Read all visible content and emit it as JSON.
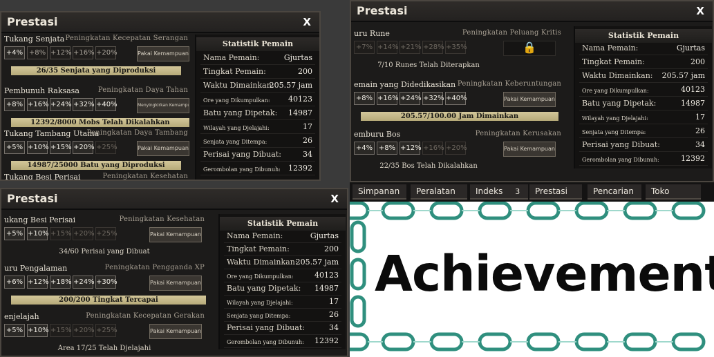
{
  "windows": [
    {
      "title": "Prestasi",
      "close": "X",
      "achievements": [
        {
          "name": "Tukang Senjata",
          "stat": "Peningkatan Kecepatan Serangan",
          "levels": [
            "+4%",
            "+8%",
            "+12%",
            "+16%",
            "+20%"
          ],
          "button": "Pakai Kemampuan",
          "progress": "26/35 Senjata yang Diproduksi"
        },
        {
          "name": "Pembunuh Raksasa",
          "stat": "Peningkatan Daya Tahan",
          "levels": [
            "+8%",
            "+16%",
            "+24%",
            "+32%",
            "+40%"
          ],
          "button": "Menyingkirkan Kemampuan",
          "progress": "12392/8000 Mobs Telah Dikalahkan"
        },
        {
          "name": "Tukang Tambang Utama",
          "stat": "Peningkatan Daya Tambang",
          "levels": [
            "+5%",
            "+10%",
            "+15%",
            "+20%",
            "+25%"
          ],
          "button": "Pakai Kemampuan",
          "progress": "14987/25000 Batu yang Diproduksi"
        },
        {
          "name": "Tukang Besi Perisai",
          "stat": "Peningkatan Kesehatan"
        }
      ],
      "stats_header": "Statistik Pemain",
      "stats": [
        {
          "k": "Nama Pemain:",
          "v": "Gjurtas"
        },
        {
          "k": "Tingkat Pemain:",
          "v": "200"
        },
        {
          "k": "Waktu Dimainkan:",
          "v": "205.57 jam"
        },
        {
          "k": "Ore yang Dikumpulkan:",
          "v": "40123"
        },
        {
          "k": "Batu yang Dipetak:",
          "v": "14987"
        },
        {
          "k": "Wilayah yang Djelajahi:",
          "v": "17"
        },
        {
          "k": "Senjata yang Ditempa:",
          "v": "26"
        },
        {
          "k": "Perisai yang Dibuat:",
          "v": "34"
        },
        {
          "k": "Gerombolan yang Dibunuh:",
          "v": "12392"
        }
      ]
    },
    {
      "title": "Prestasi",
      "close": "X",
      "achievements": [
        {
          "name": "uru Rune",
          "stat": "Peningkatan Peluang Kritis",
          "levels": [
            "+7%",
            "+14%",
            "+21%",
            "+28%",
            "+35%"
          ],
          "button": "🔒",
          "progress": "7/10 Runes Telah Diterapkan"
        },
        {
          "name": "emain yang Didedikasikan",
          "stat": "Peningkatan Keberuntungan",
          "levels": [
            "+8%",
            "+16%",
            "+24%",
            "+32%",
            "+40%"
          ],
          "button": "Pakai Kemampuan",
          "progress": "205.57/100.00 Jam Dimainkan"
        },
        {
          "name": "emburu Bos",
          "stat": "Peningkatan Kerusakan",
          "levels": [
            "+4%",
            "+8%",
            "+12%",
            "+16%",
            "+20%"
          ],
          "button": "Pakai Kemampuan",
          "progress": "22/35 Bos Telah Dikalahkan"
        }
      ],
      "stats_header": "Statistik Pemain",
      "stats": [
        {
          "k": "Nama Pemain:",
          "v": "Gjurtas"
        },
        {
          "k": "Tingkat Pemain:",
          "v": "200"
        },
        {
          "k": "Waktu Dimainkan:",
          "v": "205.57 jam"
        },
        {
          "k": "Ore yang Dikumpulkan:",
          "v": "40123"
        },
        {
          "k": "Batu yang Dipetak:",
          "v": "14987"
        },
        {
          "k": "Wilayah yang Djelajahi:",
          "v": "17"
        },
        {
          "k": "Senjata yang Ditempa:",
          "v": "26"
        },
        {
          "k": "Perisai yang Dibuat:",
          "v": "34"
        },
        {
          "k": "Gerombolan yang Dibunuh:",
          "v": "12392"
        }
      ]
    },
    {
      "title": "Prestasi",
      "close": "X",
      "achievements": [
        {
          "name": "ukang Besi Perisai",
          "stat": "Peningkatan Kesehatan",
          "levels": [
            "+5%",
            "+10%",
            "+15%",
            "+20%",
            "+25%"
          ],
          "button": "Pakai Kemampuan",
          "progress": "34/60 Perisai yang Dibuat"
        },
        {
          "name": "uru Pengalaman",
          "stat": "Peningkatan Pengganda XP",
          "levels": [
            "+6%",
            "+12%",
            "+18%",
            "+24%",
            "+30%"
          ],
          "button": "Pakai Kemampuan",
          "progress": "200/200 Tingkat Tercapai"
        },
        {
          "name": "enjelajah",
          "stat": "Peningkatan Kecepatan Gerakan",
          "levels": [
            "+5%",
            "+10%",
            "+15%",
            "+20%",
            "+25%"
          ],
          "button": "Pakai Kemampuan",
          "progress": "Area 17/25 Telah Djelajahi"
        }
      ],
      "stats_header": "Statistik Pemain",
      "stats": [
        {
          "k": "Nama Pemain:",
          "v": "Gjurtas"
        },
        {
          "k": "Tingkat Pemain:",
          "v": "200"
        },
        {
          "k": "Waktu Dimainkan:",
          "v": "205.57 jam"
        },
        {
          "k": "Ore yang Dikumpulkan:",
          "v": "40123"
        },
        {
          "k": "Batu yang Dipetak:",
          "v": "14987"
        },
        {
          "k": "Wilayah yang Djelajahi:",
          "v": "17"
        },
        {
          "k": "Senjata yang Ditempa:",
          "v": "26"
        },
        {
          "k": "Perisai yang Dibuat:",
          "v": "34"
        },
        {
          "k": "Gerombolan yang Dibunuh:",
          "v": "12392"
        }
      ]
    }
  ],
  "tabs": [
    "Simpanan",
    "Peralatan",
    "Indeks",
    "3",
    "Prestasi",
    "Pencarian",
    "Toko"
  ],
  "banner": "Achievement",
  "colors": {
    "progress_bar": "#c8bc8c",
    "panel_bg": "#1c1b1a",
    "chain": "#2f8f7e"
  }
}
